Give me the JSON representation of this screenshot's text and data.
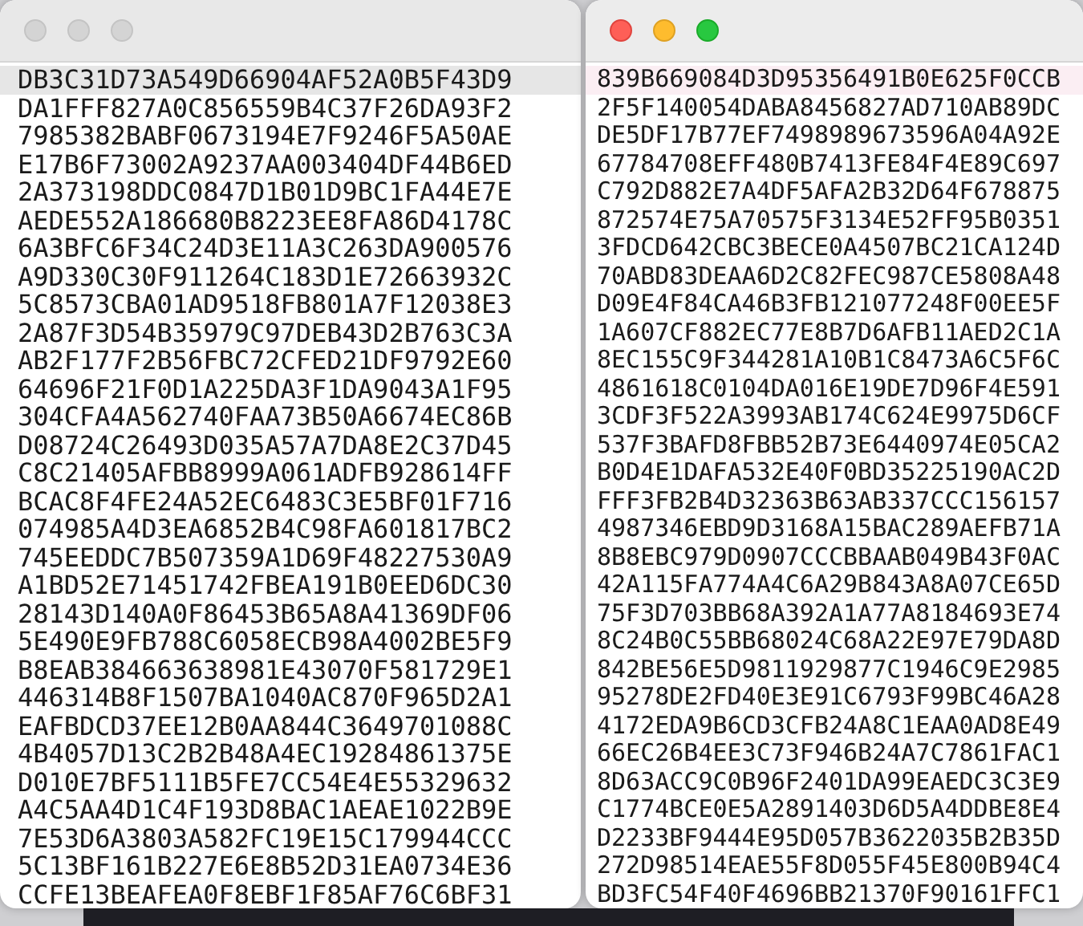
{
  "windows": [
    {
      "active": false,
      "lines": [
        {
          "text": "DB3C31D73A549D66904AF52A0B5F43D9",
          "highlighted": true
        },
        {
          "text": "DA1FFF827A0C856559B4C37F26DA93F2",
          "highlighted": false
        },
        {
          "text": "7985382BABF0673194E7F9246F5A50AE",
          "highlighted": false
        },
        {
          "text": "E17B6F73002A9237AA003404DF44B6ED",
          "highlighted": false
        },
        {
          "text": "2A373198DDC0847D1B01D9BC1FA44E7E",
          "highlighted": false
        },
        {
          "text": "AEDE552A186680B8223EE8FA86D4178C",
          "highlighted": false
        },
        {
          "text": "6A3BFC6F34C24D3E11A3C263DA900576",
          "highlighted": false
        },
        {
          "text": "A9D330C30F911264C183D1E72663932C",
          "highlighted": false
        },
        {
          "text": "5C8573CBA01AD9518FB801A7F12038E3",
          "highlighted": false
        },
        {
          "text": "2A87F3D54B35979C97DEB43D2B763C3A",
          "highlighted": false
        },
        {
          "text": "AB2F177F2B56FBC72CFED21DF9792E60",
          "highlighted": false
        },
        {
          "text": "64696F21F0D1A225DA3F1DA9043A1F95",
          "highlighted": false
        },
        {
          "text": "304CFA4A562740FAA73B50A6674EC86B",
          "highlighted": false
        },
        {
          "text": "D08724C26493D035A57A7DA8E2C37D45",
          "highlighted": false
        },
        {
          "text": "C8C21405AFBB8999A061ADFB928614FF",
          "highlighted": false
        },
        {
          "text": "BCAC8F4FE24A52EC6483C3E5BF01F716",
          "highlighted": false
        },
        {
          "text": "074985A4D3EA6852B4C98FA601817BC2",
          "highlighted": false
        },
        {
          "text": "745EEDDC7B507359A1D69F48227530A9",
          "highlighted": false
        },
        {
          "text": "A1BD52E71451742FBEA191B0EED6DC30",
          "highlighted": false
        },
        {
          "text": "28143D140A0F86453B65A8A41369DF06",
          "highlighted": false
        },
        {
          "text": "5E490E9FB788C6058ECB98A4002BE5F9",
          "highlighted": false
        },
        {
          "text": "B8EAB384663638981E43070F581729E1",
          "highlighted": false
        },
        {
          "text": "446314B8F1507BA1040AC870F965D2A1",
          "highlighted": false
        },
        {
          "text": "EAFBDCD37EE12B0AA844C3649701088C",
          "highlighted": false
        },
        {
          "text": "4B4057D13C2B2B48A4EC19284861375E",
          "highlighted": false
        },
        {
          "text": "D010E7BF5111B5FE7CC54E4E55329632",
          "highlighted": false
        },
        {
          "text": "A4C5AA4D1C4F193D8BAC1AEAE1022B9E",
          "highlighted": false
        },
        {
          "text": "7E53D6A3803A582FC19E15C179944CCC",
          "highlighted": false
        },
        {
          "text": "5C13BF161B227E6E8B52D31EA0734E36",
          "highlighted": false
        },
        {
          "text": "CCFE13BEAFEA0F8EBF1F85AF76C6BF31",
          "highlighted": false
        }
      ]
    },
    {
      "active": true,
      "lines": [
        {
          "text": "839B669084D3D95356491B0E625F0CCB",
          "highlighted": true
        },
        {
          "text": "2F5F140054DABA8456827AD710AB89DC",
          "highlighted": false
        },
        {
          "text": "DE5DF17B77EF7498989673596A04A92E",
          "highlighted": false
        },
        {
          "text": "67784708EFF480B7413FE84F4E89C697",
          "highlighted": false
        },
        {
          "text": "C792D882E7A4DF5AFA2B32D64F678875",
          "highlighted": false
        },
        {
          "text": "872574E75A70575F3134E52FF95B0351",
          "highlighted": false
        },
        {
          "text": "3FDCD642CBC3BECE0A4507BC21CA124D",
          "highlighted": false
        },
        {
          "text": "70ABD83DEAA6D2C82FEC987CE5808A48",
          "highlighted": false
        },
        {
          "text": "D09E4F84CA46B3FB121077248F00EE5F",
          "highlighted": false
        },
        {
          "text": "1A607CF882EC77E8B7D6AFB11AED2C1A",
          "highlighted": false
        },
        {
          "text": "8EC155C9F344281A10B1C8473A6C5F6C",
          "highlighted": false
        },
        {
          "text": "4861618C0104DA016E19DE7D96F4E591",
          "highlighted": false
        },
        {
          "text": "3CDF3F522A3993AB174C624E9975D6CF",
          "highlighted": false
        },
        {
          "text": "537F3BAFD8FBB52B73E6440974E05CA2",
          "highlighted": false
        },
        {
          "text": "B0D4E1DAFA532E40F0BD35225190AC2D",
          "highlighted": false
        },
        {
          "text": "FFF3FB2B4D32363B63AB337CCC156157",
          "highlighted": false
        },
        {
          "text": "4987346EBD9D3168A15BAC289AEFB71A",
          "highlighted": false
        },
        {
          "text": "8B8EBC979D0907CCCBBAAB049B43F0AC",
          "highlighted": false
        },
        {
          "text": "42A115FA774A4C6A29B843A8A07CE65D",
          "highlighted": false
        },
        {
          "text": "75F3D703BB68A392A1A77A8184693E74",
          "highlighted": false
        },
        {
          "text": "8C24B0C55BB68024C68A22E97E79DA8D",
          "highlighted": false
        },
        {
          "text": "842BE56E5D9811929877C1946C9E2985",
          "highlighted": false
        },
        {
          "text": "95278DE2FD40E3E91C6793F99BC46A28",
          "highlighted": false
        },
        {
          "text": "4172EDA9B6CD3CFB24A8C1EAA0AD8E49",
          "highlighted": false
        },
        {
          "text": "66EC26B4EE3C73F946B24A7C7861FAC1",
          "highlighted": false
        },
        {
          "text": "8D63ACC9C0B96F2401DA99EAEDC3C3E9",
          "highlighted": false
        },
        {
          "text": "C1774BCE0E5A2891403D6D5A4DDBE8E4",
          "highlighted": false
        },
        {
          "text": "D2233BF9444E95D057B3622035B2B35D",
          "highlighted": false
        },
        {
          "text": "272D98514EAE55F8D055F45E800B94C4",
          "highlighted": false
        },
        {
          "text": "BD3FC54F40F4696BB21370F90161FFC1",
          "highlighted": false
        }
      ]
    }
  ]
}
